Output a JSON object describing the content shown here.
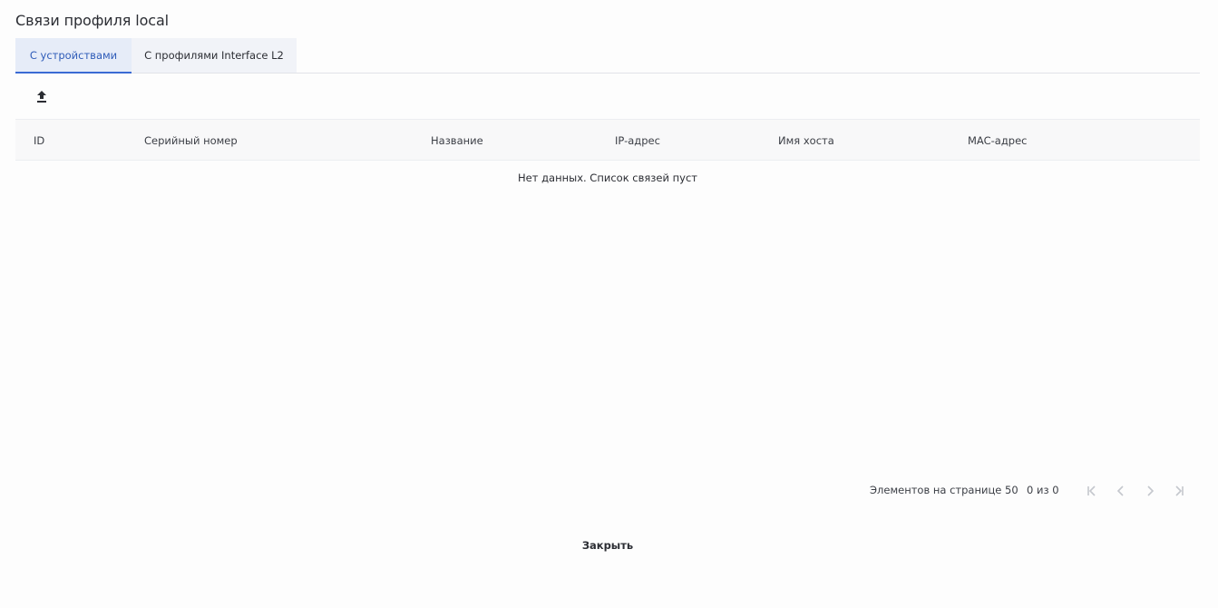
{
  "dialog": {
    "title": "Связи профиля local"
  },
  "tabs": [
    {
      "label": "С устройствами",
      "active": true
    },
    {
      "label": "С профилями Interface L2",
      "active": false
    }
  ],
  "toolbar": {
    "upload_icon": "upload-icon"
  },
  "table": {
    "columns": [
      "ID",
      "Серийный номер",
      "Название",
      "IP-адрес",
      "Имя хоста",
      "MAC-адрес"
    ],
    "rows": [],
    "empty_message": "Нет данных. Список связей пуст"
  },
  "pagination": {
    "page_size_label": "Элементов на странице 50",
    "range_label": "0 из 0",
    "icons": [
      "first-page-icon",
      "prev-page-icon",
      "next-page-icon",
      "last-page-icon"
    ]
  },
  "footer": {
    "close_label": "Закрыть"
  },
  "colors": {
    "accent": "#3a6ad4",
    "active_tab_bg": "#e6ecf8",
    "disabled_icon": "#c4c7cd"
  }
}
